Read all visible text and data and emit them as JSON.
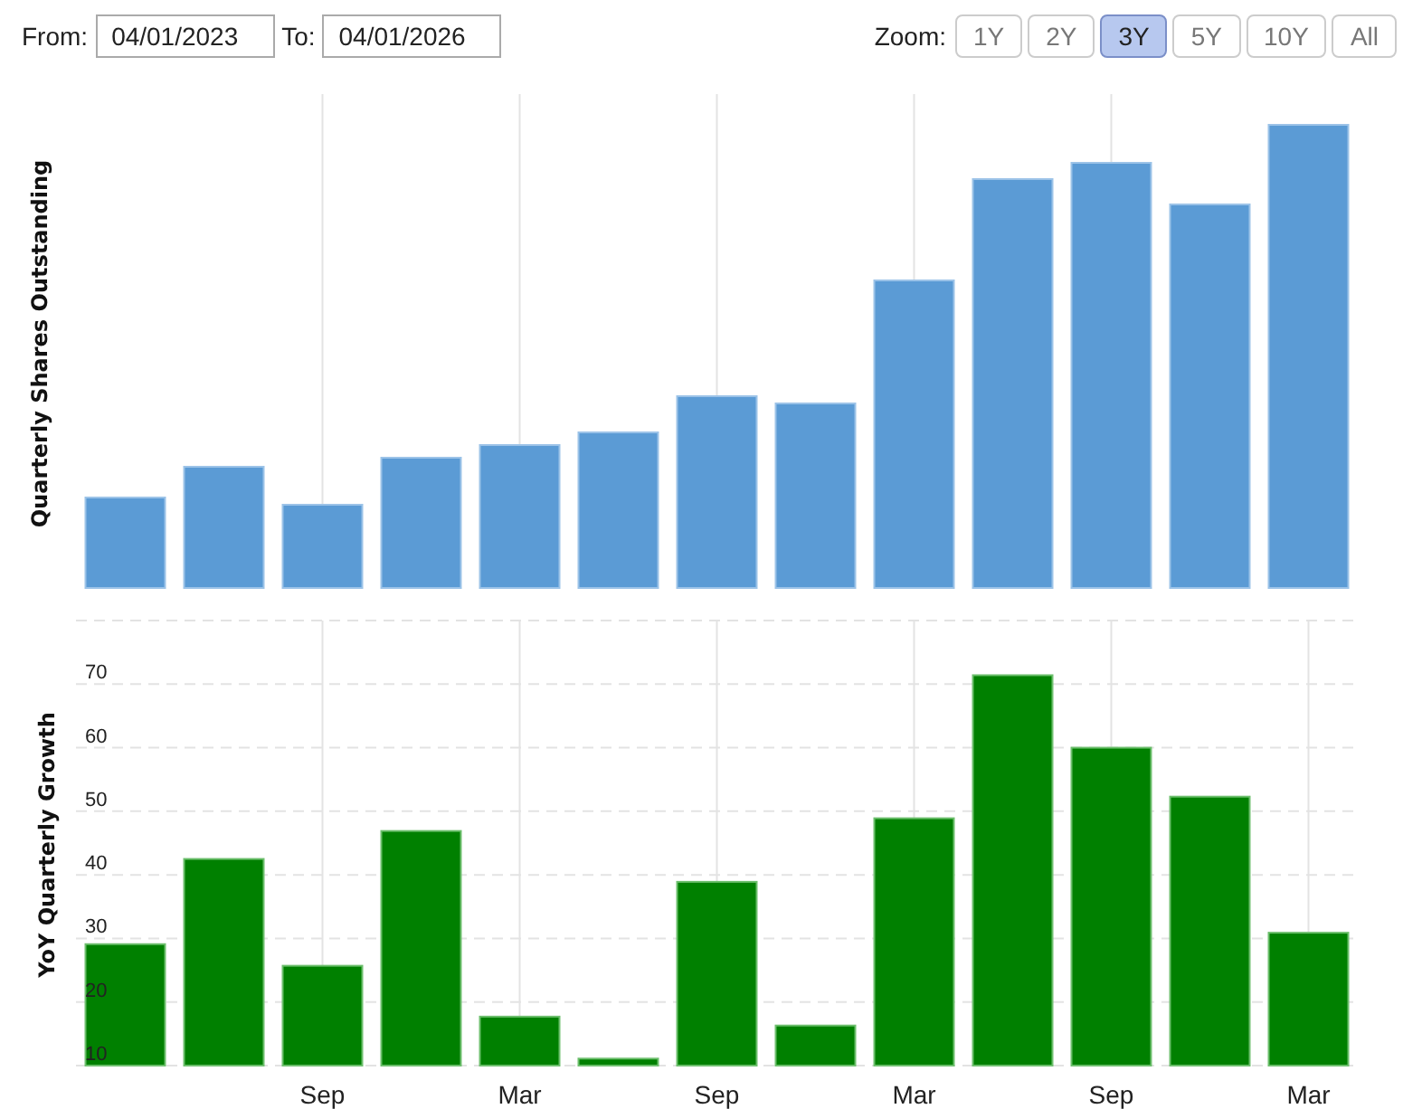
{
  "date_range": {
    "from_label": "From:",
    "from_value": "04/01/2023",
    "to_label": "To:",
    "to_value": "04/01/2026"
  },
  "zoom": {
    "label": "Zoom:",
    "options": [
      {
        "label": "1Y",
        "selected": false
      },
      {
        "label": "2Y",
        "selected": false
      },
      {
        "label": "3Y",
        "selected": true
      },
      {
        "label": "5Y",
        "selected": false
      },
      {
        "label": "10Y",
        "selected": false
      },
      {
        "label": "All",
        "selected": false
      }
    ]
  },
  "shares_chart": {
    "ylabel": "Quarterly Shares Outstanding"
  },
  "growth_chart": {
    "chart_data": {
      "type": "bar",
      "ylabel": "YoY Quarterly Growth",
      "categories": [
        null,
        null,
        "Sep",
        null,
        "Mar",
        null,
        "Sep",
        null,
        "Mar",
        null,
        "Sep",
        null,
        "Mar"
      ],
      "series": [
        {
          "color": "#008000",
          "values": [
            29.1,
            42.5,
            25.7,
            46.9,
            17.7,
            11.1,
            38.9,
            16.3,
            48.9,
            71.4,
            60,
            52.3,
            30.9
          ]
        }
      ],
      "ylim": [
        10,
        80
      ],
      "grid": true,
      "yticks": [
        {
          "value": 10,
          "label": "10"
        },
        {
          "value": 20,
          "label": "20"
        },
        {
          "value": 30,
          "label": "30"
        },
        {
          "value": 40,
          "label": "40"
        },
        {
          "value": 50,
          "label": "50"
        },
        {
          "value": 60,
          "label": "60"
        },
        {
          "value": 70,
          "label": "70"
        }
      ]
    }
  }
}
